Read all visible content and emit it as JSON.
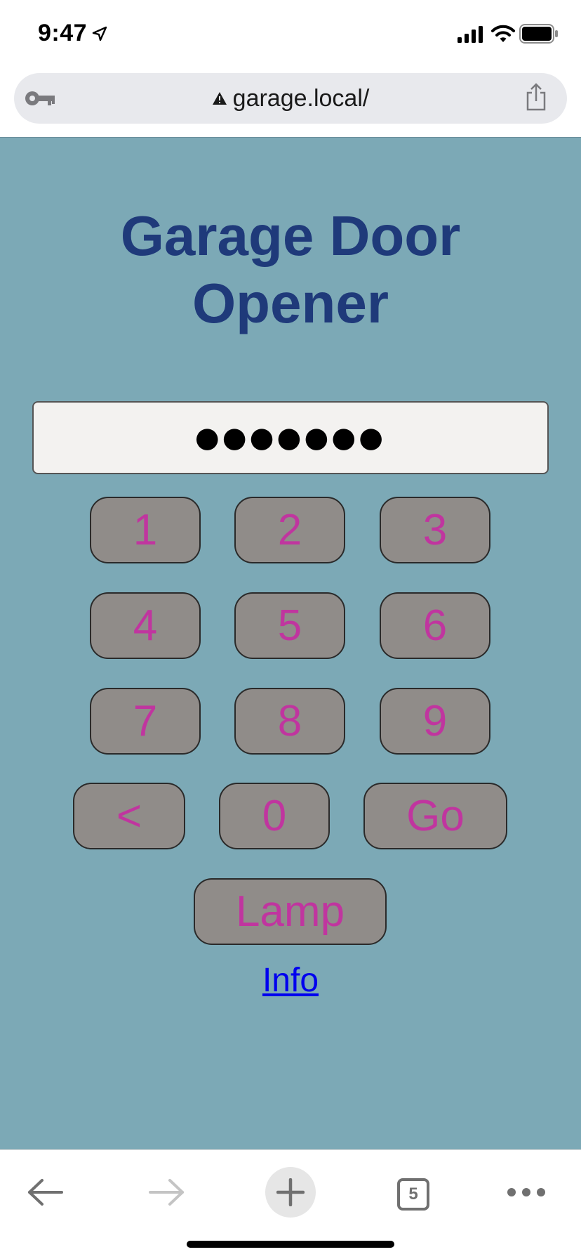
{
  "status_bar": {
    "time": "9:47",
    "icons": [
      "location-arrow-icon",
      "cellular-signal-icon",
      "wifi-icon",
      "battery-icon"
    ]
  },
  "browser": {
    "url": "garage.local/",
    "url_icons": [
      "key-icon",
      "warning-icon",
      "share-icon"
    ],
    "tab_count": "5",
    "toolbar_icons": [
      "back-arrow-icon",
      "forward-arrow-icon",
      "plus-icon",
      "tabs-icon",
      "more-icon"
    ]
  },
  "page": {
    "title_line1": "Garage Door",
    "title_line2": "Opener",
    "pin_value": "●●●●●●●",
    "keypad": {
      "k1": "1",
      "k2": "2",
      "k3": "3",
      "k4": "4",
      "k5": "5",
      "k6": "6",
      "k7": "7",
      "k8": "8",
      "k9": "9",
      "backspace": "<",
      "k0": "0",
      "go": "Go",
      "lamp": "Lamp"
    },
    "info_link": "Info"
  },
  "colors": {
    "page_background": "#7ca9b6",
    "title": "#1f3a7a",
    "key_background": "#908c89",
    "key_text": "#c0359f",
    "link": "#0000ee"
  }
}
